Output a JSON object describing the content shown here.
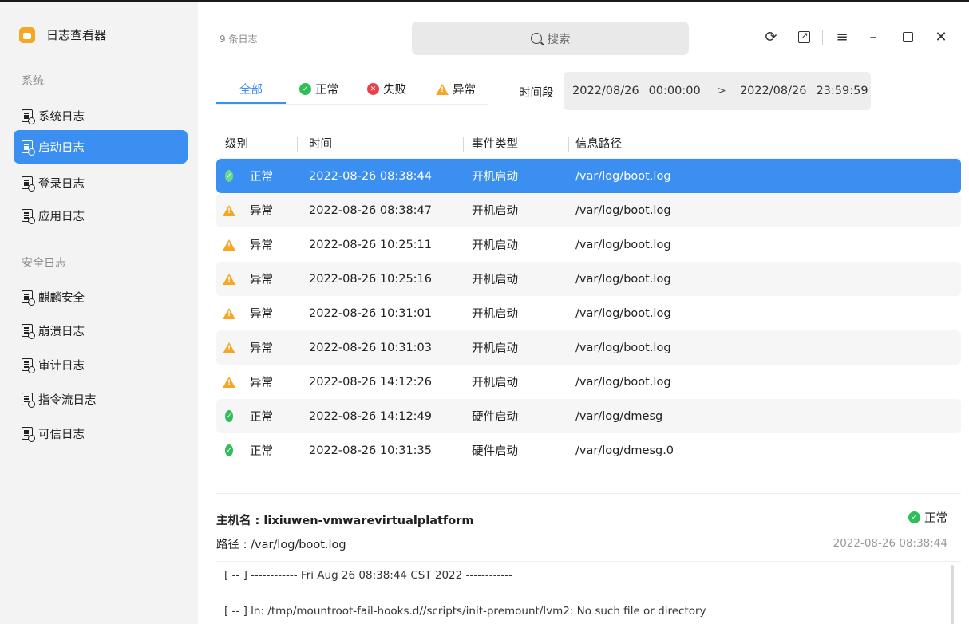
{
  "sidebar": {
    "app_title": "日志查看器",
    "group_system": "系统",
    "group_security": "安全日志",
    "items": [
      {
        "label": "系统日志"
      },
      {
        "label": "启动日志"
      },
      {
        "label": "登录日志"
      },
      {
        "label": "应用日志"
      },
      {
        "label": "麒麟安全"
      },
      {
        "label": "崩溃日志"
      },
      {
        "label": "审计日志"
      },
      {
        "label": "指令流日志"
      },
      {
        "label": "可信日志"
      }
    ]
  },
  "header": {
    "count": "9 条日志",
    "search_placeholder": "搜索",
    "icons": [
      "refresh-icon",
      "export-icon",
      "menu-icon",
      "minimize-icon",
      "maximize-icon",
      "close-icon"
    ]
  },
  "tabs": {
    "all": "全部",
    "normal": "正常",
    "failed": "失败",
    "abnormal": "异常"
  },
  "period": {
    "label": "时间段",
    "start_date": "2022/08/26",
    "start_time": "00:00:00",
    "arrow": ">",
    "end_date": "2022/08/26",
    "end_time": "23:59:59"
  },
  "table": {
    "headers": [
      "级别",
      "时间",
      "事件类型",
      "信息路径"
    ],
    "rows": [
      {
        "level": "正常",
        "status": "ok",
        "time": "2022-08-26 08:38:44",
        "type": "开机启动",
        "path": "/var/log/boot.log"
      },
      {
        "level": "异常",
        "status": "warn",
        "time": "2022-08-26 08:38:47",
        "type": "开机启动",
        "path": "/var/log/boot.log"
      },
      {
        "level": "异常",
        "status": "warn",
        "time": "2022-08-26 10:25:11",
        "type": "开机启动",
        "path": "/var/log/boot.log"
      },
      {
        "level": "异常",
        "status": "warn",
        "time": "2022-08-26 10:25:16",
        "type": "开机启动",
        "path": "/var/log/boot.log"
      },
      {
        "level": "异常",
        "status": "warn",
        "time": "2022-08-26 10:31:01",
        "type": "开机启动",
        "path": "/var/log/boot.log"
      },
      {
        "level": "异常",
        "status": "warn",
        "time": "2022-08-26 10:31:03",
        "type": "开机启动",
        "path": "/var/log/boot.log"
      },
      {
        "level": "异常",
        "status": "warn",
        "time": "2022-08-26 14:12:26",
        "type": "开机启动",
        "path": "/var/log/boot.log"
      },
      {
        "level": "正常",
        "status": "ok",
        "time": "2022-08-26 14:12:49",
        "type": "硬件启动",
        "path": "/var/log/dmesg"
      },
      {
        "level": "正常",
        "status": "ok",
        "time": "2022-08-26 10:31:35",
        "type": "硬件启动",
        "path": "/var/log/dmesg.0"
      }
    ]
  },
  "detail": {
    "host": "主机名 : lixiuwen-vmwarevirtualplatform",
    "path": "路径 : /var/log/boot.log",
    "status": "正常",
    "time": "2022-08-26 08:38:44",
    "lines": [
      "[ -- ] ------------ Fri Aug 26 08:38:44 CST 2022 ------------",
      "[ -- ] ln: /tmp/mountroot-fail-hooks.d//scripts/init-premount/lvm2: No such file or directory"
    ]
  },
  "colors": {
    "accent": "#3b8ff0",
    "ok": "#2fbe58",
    "fail": "#e8414a",
    "warn": "#f5a623"
  }
}
